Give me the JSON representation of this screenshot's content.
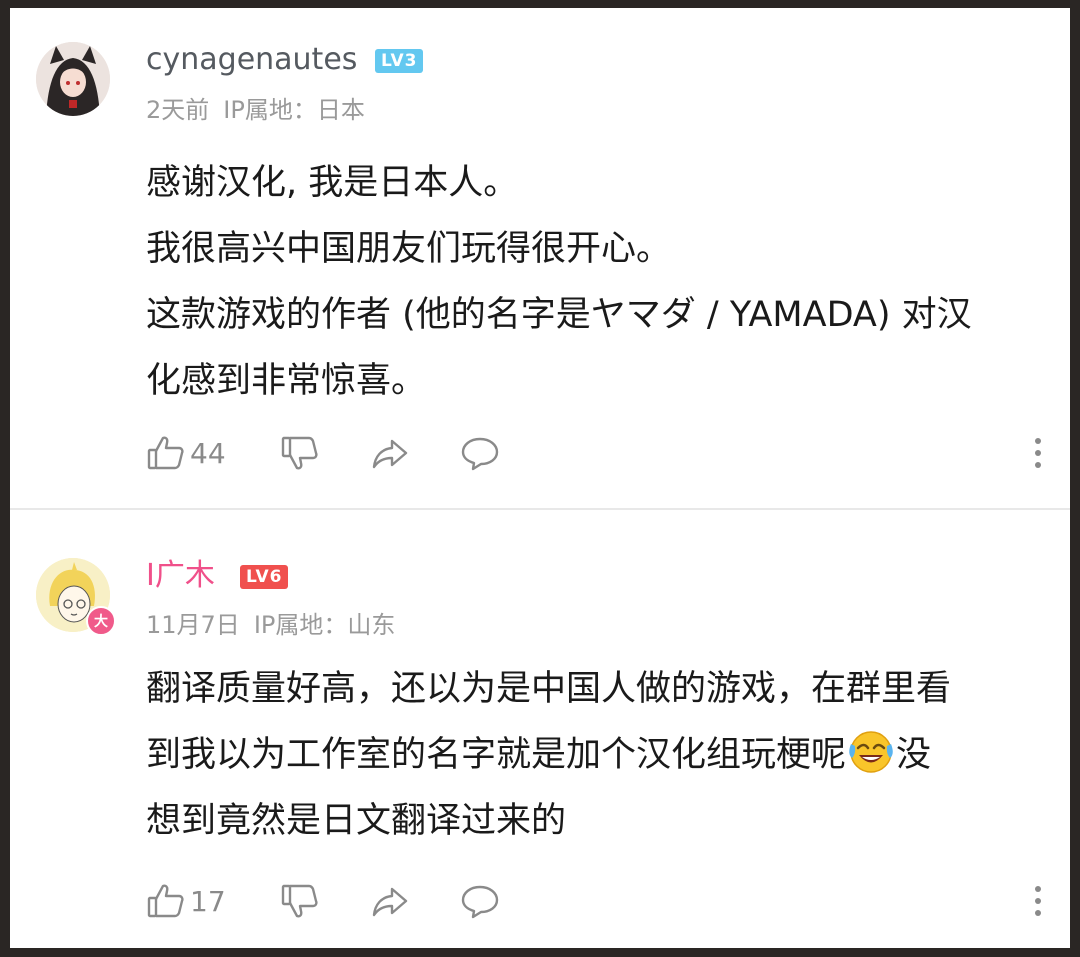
{
  "comments": [
    {
      "username": "cynagenautes",
      "level": "LV3",
      "time": "2天前",
      "ip": "IP属地：日本",
      "lines": [
        "感谢汉化, 我是日本人。",
        "我很高兴中国朋友们玩得很开心。",
        "这款游戏的作者 (他的名字是ヤマダ / YAMADA) 对汉",
        "化感到非常惊喜。"
      ],
      "likes": "44"
    },
    {
      "username": "I广木",
      "level": "LV6",
      "avatar_badge": "大",
      "time": "11月7日",
      "ip": "IP属地：山东",
      "lines": [
        "翻译质量好高，还以为是中国人做的游戏，在群里看",
        "到我以为工作室的名字就是加个汉化组玩梗呢",
        "想到竟然是日文翻译过来的"
      ],
      "line2_suffix": "没",
      "emoji": "laughing-crying-emoji",
      "likes": "17"
    }
  ],
  "colors": {
    "username_default": "#555a60",
    "username_vip": "#f0508a",
    "lv3": "#63c8f0",
    "lv6": "#f0504e",
    "meta": "#9a9a9a"
  }
}
